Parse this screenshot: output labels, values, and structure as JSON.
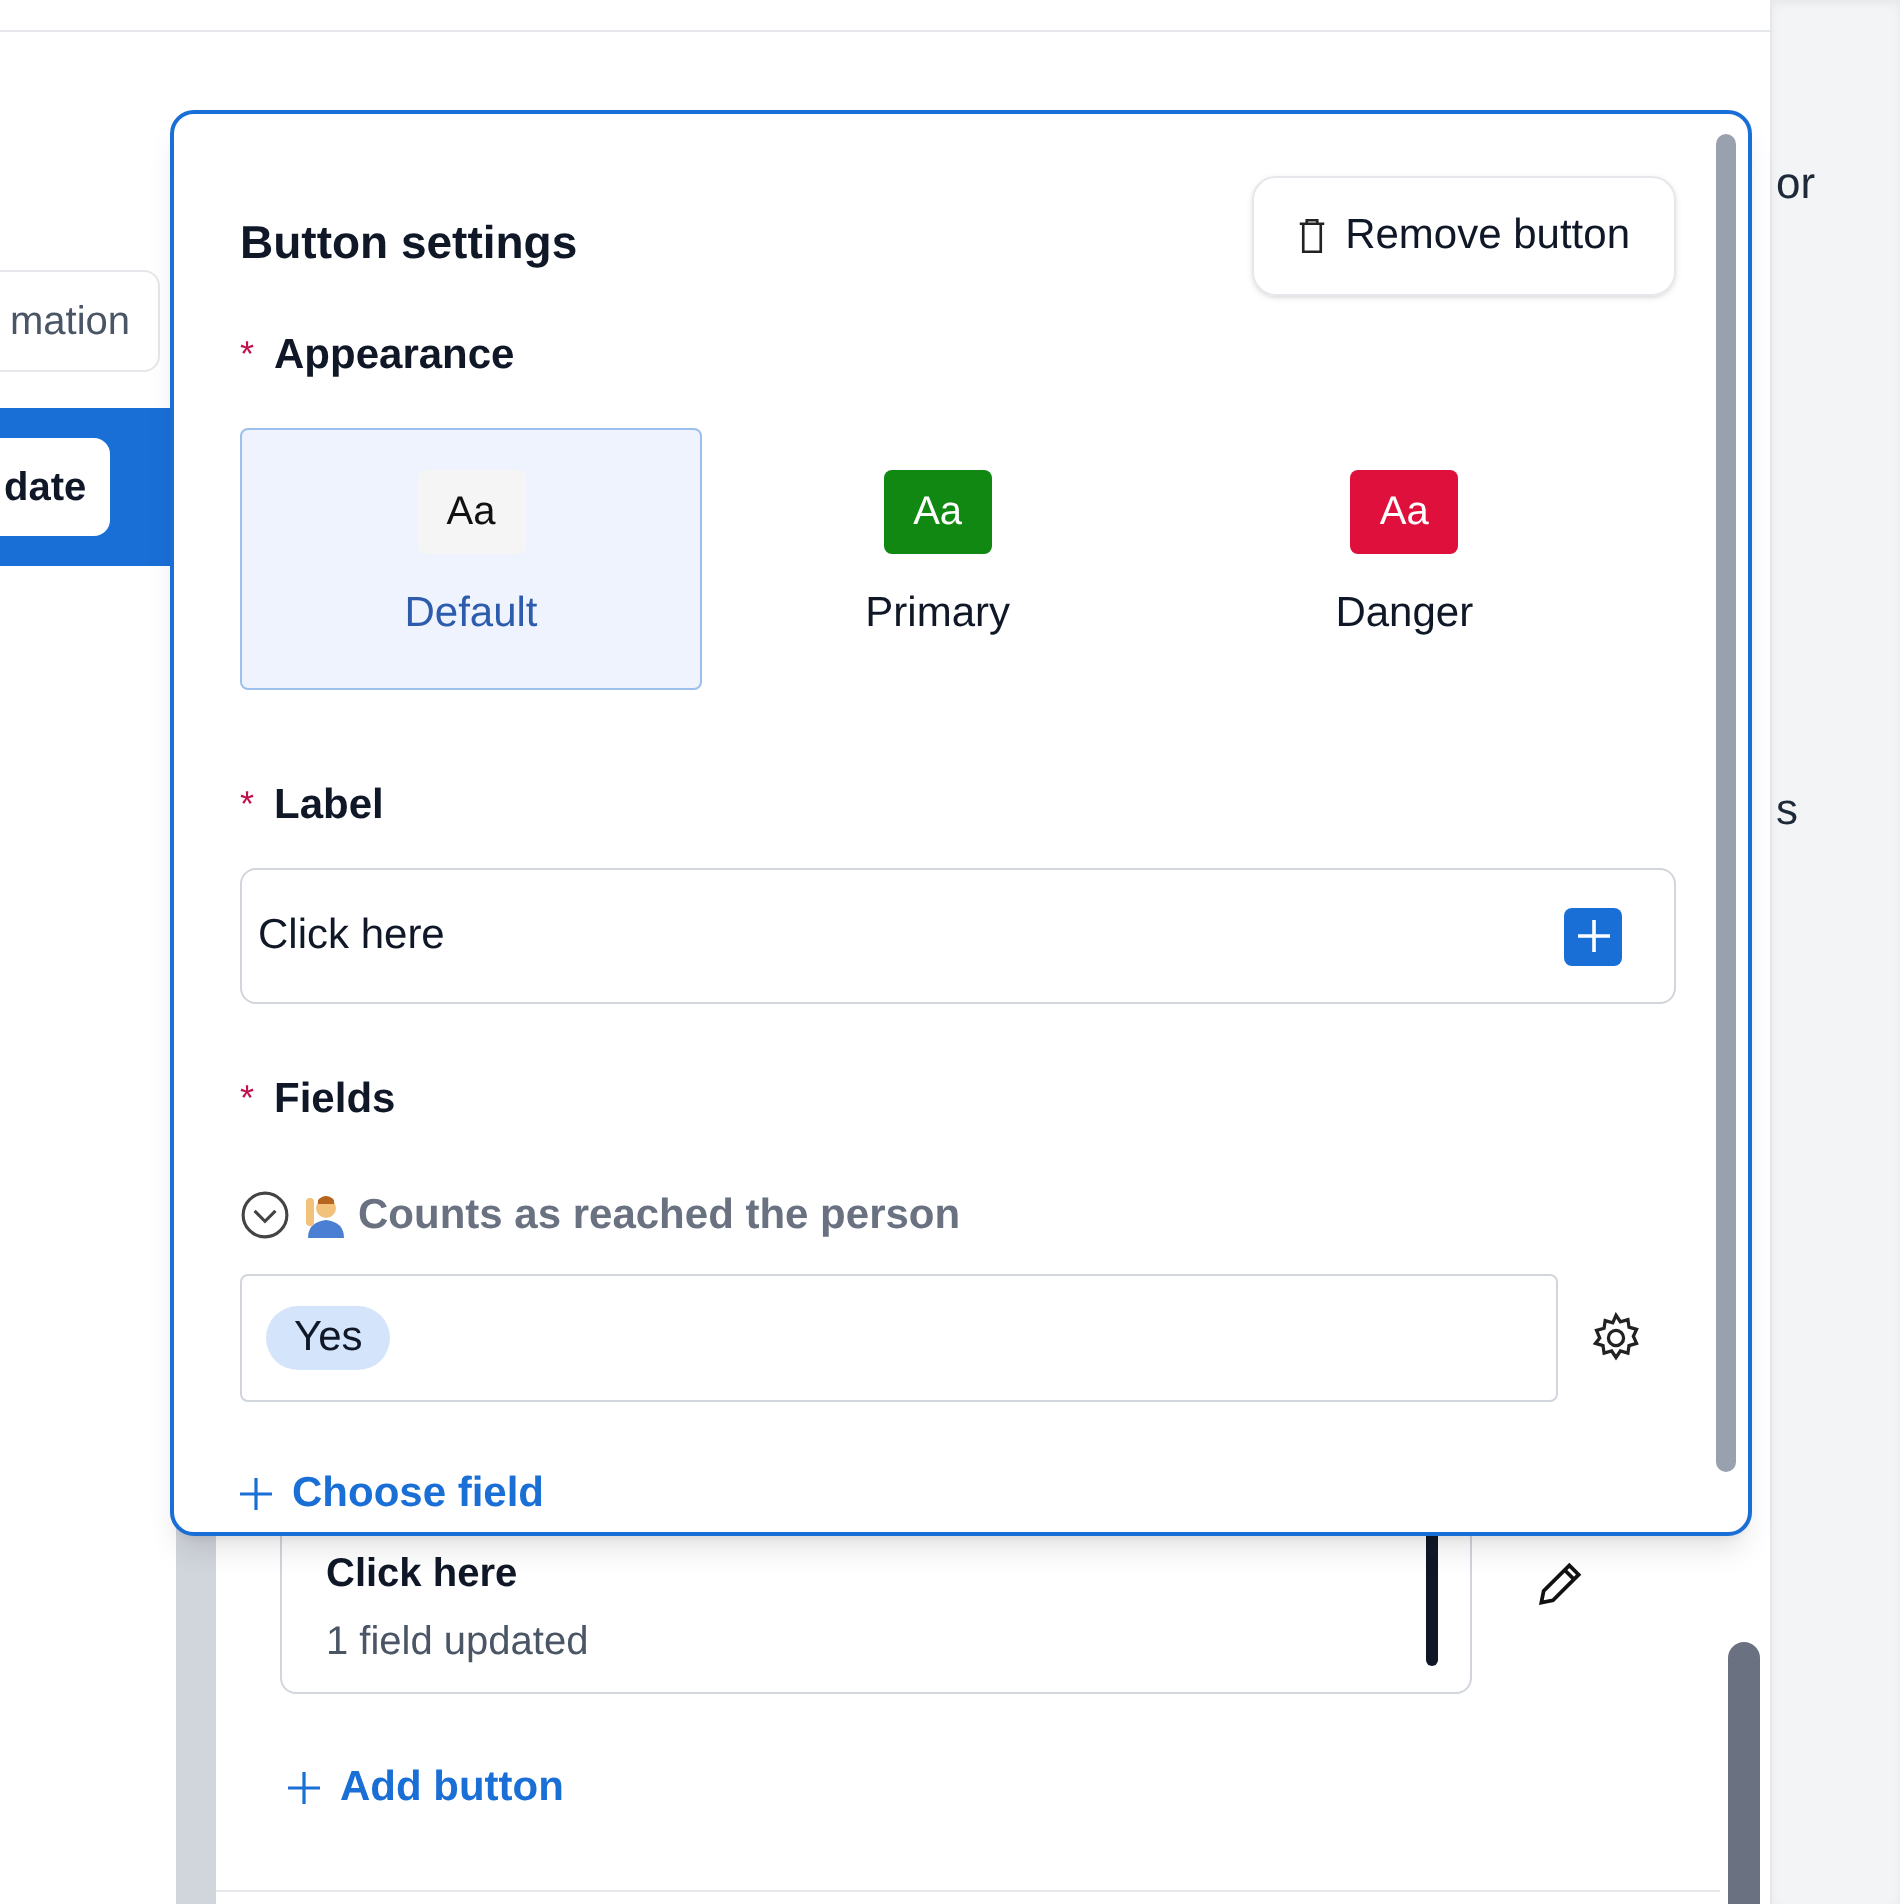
{
  "background": {
    "tab_partial": "mation",
    "active_item_partial": "date",
    "right_text_1": "or",
    "right_text_2": "s",
    "button_card": {
      "label": "Click here",
      "summary": "1 field updated"
    },
    "add_button": "Add button"
  },
  "popover": {
    "title": "Button settings",
    "remove_button": "Remove button",
    "appearance": {
      "label": "Appearance",
      "required_mark": "*",
      "options": [
        {
          "swatch": "Aa",
          "label": "Default",
          "selected": true,
          "color": "#f5f5f5"
        },
        {
          "swatch": "Aa",
          "label": "Primary",
          "selected": false,
          "color": "#118811"
        },
        {
          "swatch": "Aa",
          "label": "Danger",
          "selected": false,
          "color": "#e0103c"
        }
      ]
    },
    "label_field": {
      "label": "Label",
      "required_mark": "*",
      "value": "Click here"
    },
    "fields": {
      "label": "Fields",
      "required_mark": "*",
      "items": [
        {
          "name": "Counts as reached the person",
          "expanded": true,
          "values": [
            "Yes"
          ]
        }
      ],
      "choose_field": "Choose field"
    }
  }
}
